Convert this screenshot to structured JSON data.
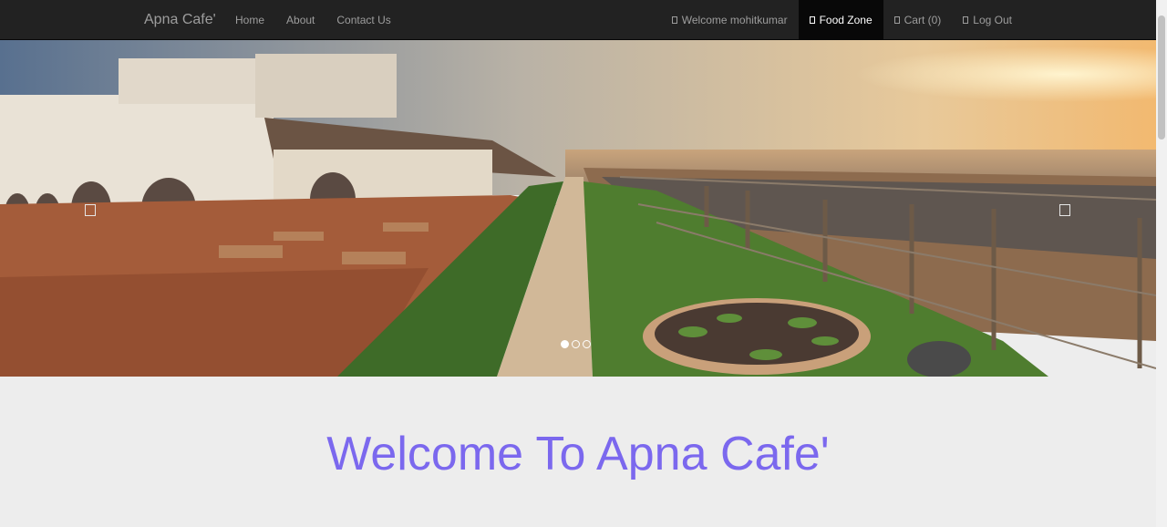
{
  "navbar": {
    "brand": "Apna Cafe'",
    "left_links": [
      {
        "label": "Home"
      },
      {
        "label": "About"
      },
      {
        "label": "Contact Us"
      }
    ],
    "right_links": [
      {
        "label": "Welcome mohitkumar",
        "icon": "user-icon"
      },
      {
        "label": "Food Zone",
        "icon": "food-icon",
        "active": true
      },
      {
        "label": "Cart (0)",
        "icon": "cart-icon"
      },
      {
        "label": "Log Out",
        "icon": "logout-icon"
      }
    ]
  },
  "carousel": {
    "slide_count": 3,
    "active_slide": 1,
    "controls": [
      "chevron-left-icon",
      "chevron-right-icon"
    ]
  },
  "main": {
    "heading": "Welcome To Apna Cafe'",
    "heading_color": "#7b68ee"
  },
  "colors": {
    "navbar_bg": "#222222",
    "nav_text": "#9d9d9d",
    "nav_active_text": "#ffffff",
    "page_bg": "#ededed"
  }
}
